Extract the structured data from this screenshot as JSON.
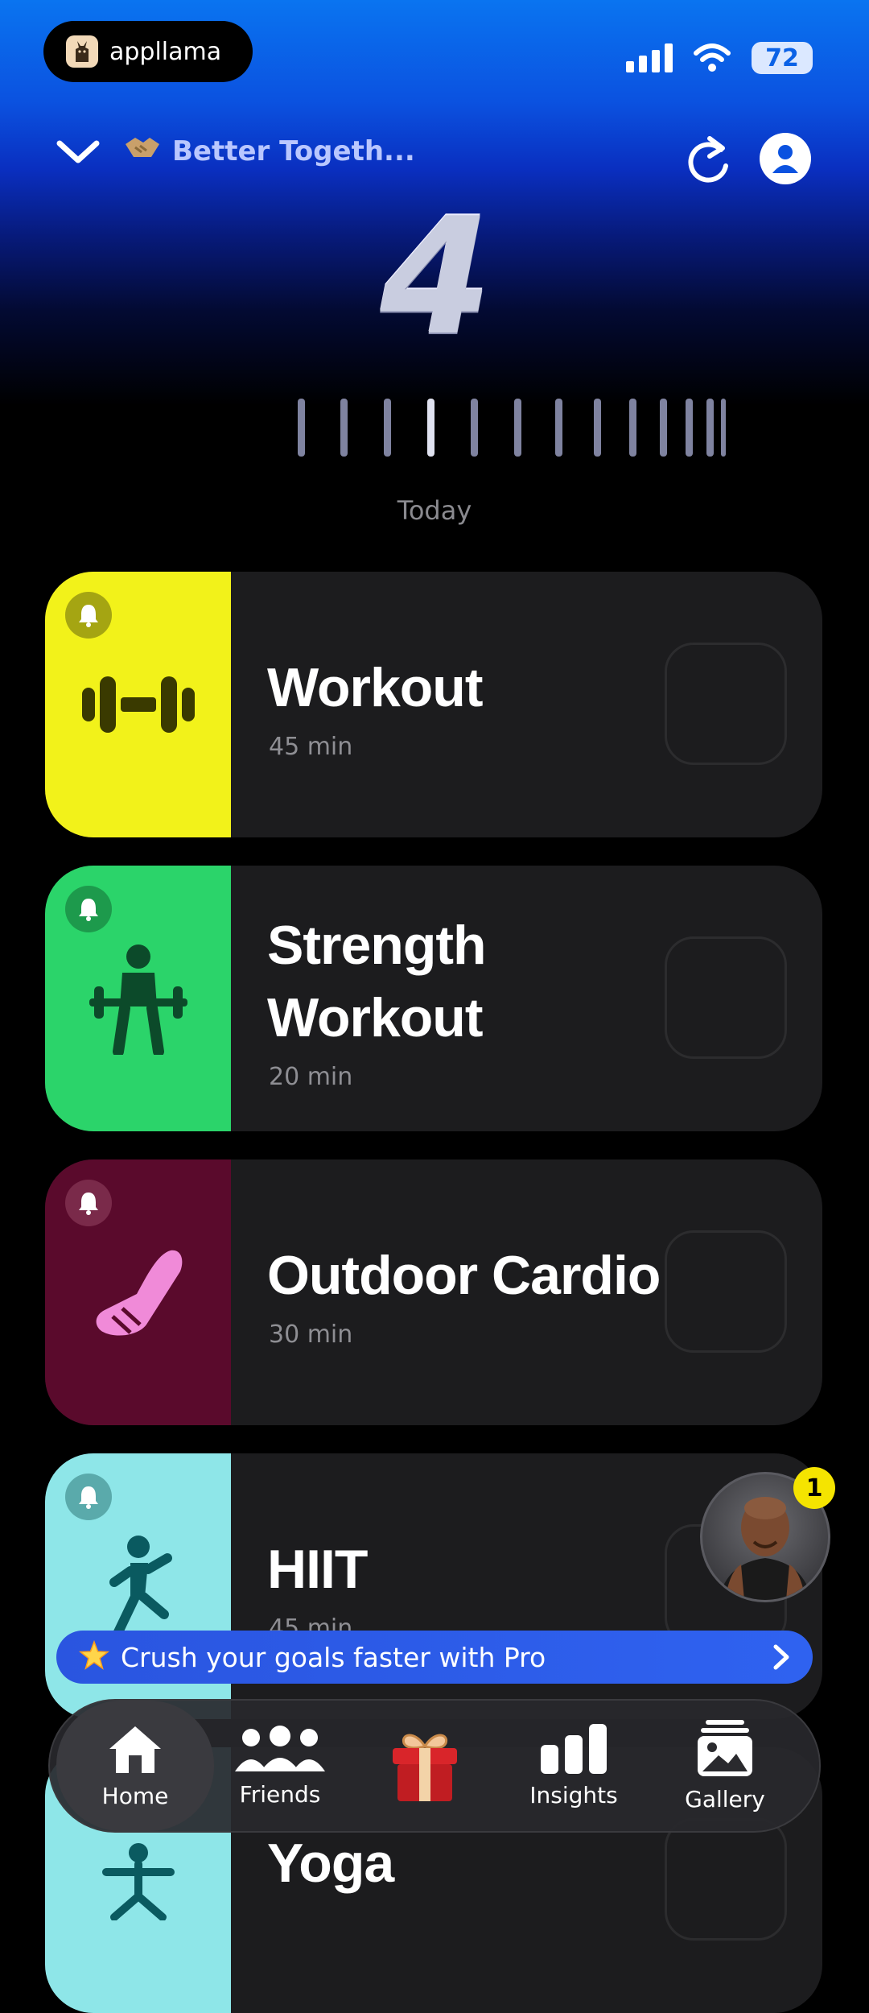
{
  "status_bar": {
    "app_name": "appllama",
    "battery": "72"
  },
  "header": {
    "team_name": "Better Togeth..."
  },
  "streak": {
    "value": "4",
    "date_label": "Today"
  },
  "habits": [
    {
      "title_lines": [
        "Workout"
      ],
      "duration": "45 min",
      "color": "#f2f21a",
      "icon": "dumbbell-icon"
    },
    {
      "title_lines": [
        "Strength",
        "Workout"
      ],
      "duration": "20 min",
      "color": "#2bd46a",
      "icon": "weightlifter-icon"
    },
    {
      "title_lines": [
        "Outdoor Cardio"
      ],
      "duration": "30 min",
      "color": "#5a0a2c",
      "icon": "sneaker-icon"
    },
    {
      "title_lines": [
        "HIIT"
      ],
      "duration": "45 min",
      "color": "#8ee6e8",
      "icon": "runner-icon"
    },
    {
      "title_lines": [
        "Yoga"
      ],
      "duration": "",
      "color": "#8ee6e8",
      "icon": "yoga-icon"
    }
  ],
  "coach": {
    "badge": "1"
  },
  "promo": {
    "text": "Crush your goals faster with Pro"
  },
  "tabs": [
    {
      "label": "Home",
      "icon": "home-icon",
      "active": true
    },
    {
      "label": "Friends",
      "icon": "friends-icon",
      "active": false
    },
    {
      "label": "",
      "icon": "gift-icon",
      "active": false
    },
    {
      "label": "Insights",
      "icon": "bar-chart-icon",
      "active": false
    },
    {
      "label": "Gallery",
      "icon": "gallery-icon",
      "active": false
    }
  ]
}
